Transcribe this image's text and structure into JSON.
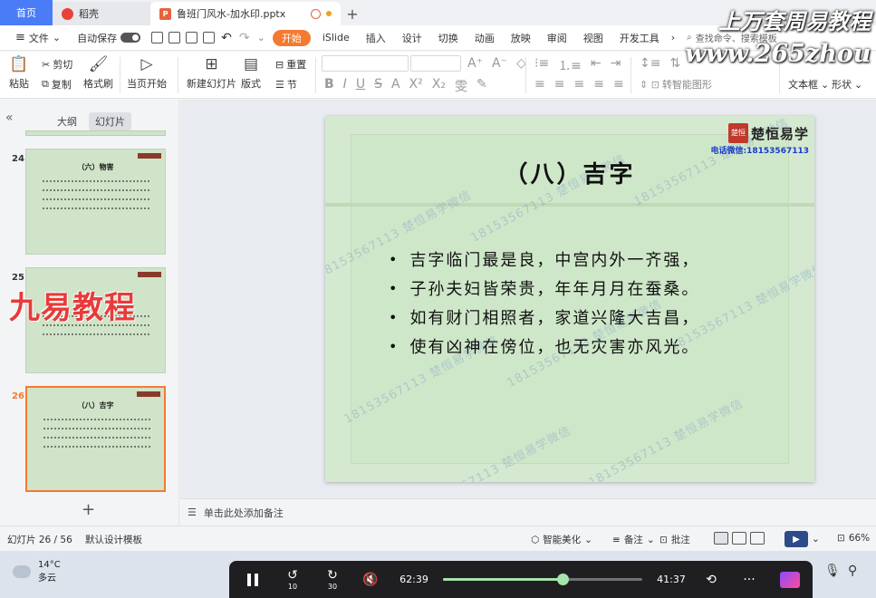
{
  "titlebar": {
    "home_tab": "首页",
    "wps_tab": "稻壳",
    "file_tab": "鲁班门风水-加水印.pptx",
    "add_tab": "+"
  },
  "watermarks": {
    "top_line1": "上万套周易教程",
    "top_line2": "www.265zhou",
    "left": "九易教程",
    "diagonal": "18153567113 楚恒易学微信"
  },
  "menubar": {
    "file": "文件",
    "autosave": "自动保存",
    "tabs": [
      "开始",
      "iSlide",
      "插入",
      "设计",
      "切换",
      "动画",
      "放映",
      "审阅",
      "视图",
      "开发工具"
    ],
    "active_tab": "开始",
    "search": "查找命令、搜索模板"
  },
  "ribbon": {
    "paste": "粘贴",
    "cut": "剪切",
    "copy": "复制",
    "format_painter": "格式刷",
    "from_current": "当页开始",
    "new_slide": "新建幻灯片",
    "layout": "版式",
    "reset": "重置",
    "section": "节",
    "convert_smartart": "转智能图形",
    "textbox": "文本框",
    "shape": "形状"
  },
  "leftpanel": {
    "outline_tab": "大纲",
    "slides_tab": "幻灯片",
    "add_button": "+",
    "thumbnails": [
      {
        "num": "24",
        "title": "（六）物害"
      },
      {
        "num": "25",
        "title": ""
      },
      {
        "num": "26",
        "title": "（八）吉字"
      }
    ]
  },
  "slide": {
    "title": "（八）吉字",
    "logo_seal": "楚恒",
    "logo_name": "楚恒易学",
    "logo_phone": "电话微信:18153567113",
    "bullets": [
      "吉字临门最是良，中宫内外一齐强，",
      "子孙夫妇皆荣贵，年年月月在蚕桑。",
      "如有财门相照者，家道兴隆大吉昌，",
      "使有凶神在傍位，也无灾害亦风光。"
    ]
  },
  "notes": {
    "placeholder": "单击此处添加备注"
  },
  "statusbar": {
    "slide_count": "幻灯片 26 / 56",
    "template": "默认设计模板",
    "beautify": "智能美化",
    "notes": "备注",
    "comments": "批注",
    "zoom": "66%"
  },
  "taskbar": {
    "temperature": "14°C",
    "weather": "多云"
  },
  "video": {
    "elapsed": "62:39",
    "remaining": "41:37",
    "skip_back": "10",
    "skip_forward": "30",
    "progress": 0.6
  }
}
